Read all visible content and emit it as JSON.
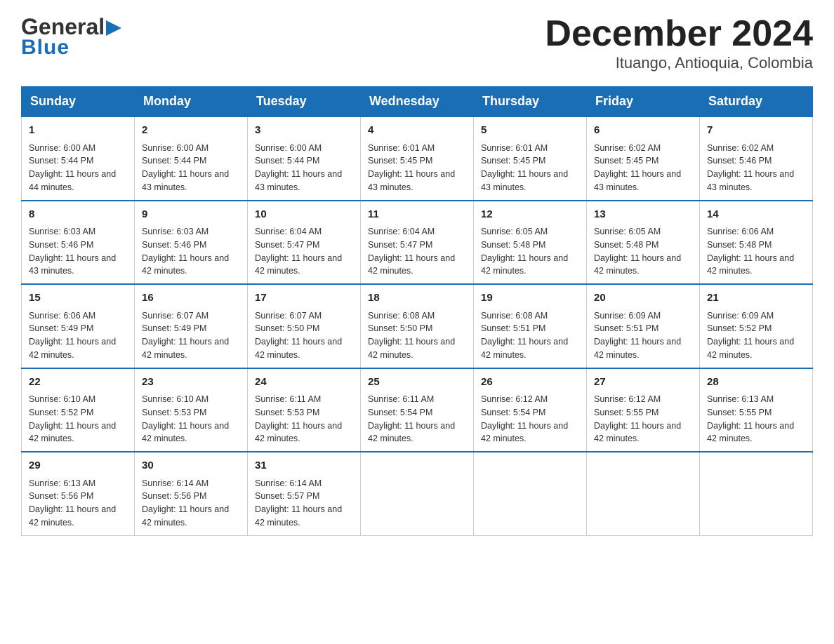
{
  "header": {
    "logo_top": "General",
    "logo_arrow": "▶",
    "logo_bottom": "Blue",
    "title": "December 2024",
    "subtitle": "Ituango, Antioquia, Colombia"
  },
  "calendar": {
    "days_of_week": [
      "Sunday",
      "Monday",
      "Tuesday",
      "Wednesday",
      "Thursday",
      "Friday",
      "Saturday"
    ],
    "weeks": [
      [
        {
          "day": "1",
          "sunrise": "6:00 AM",
          "sunset": "5:44 PM",
          "daylight": "11 hours and 44 minutes."
        },
        {
          "day": "2",
          "sunrise": "6:00 AM",
          "sunset": "5:44 PM",
          "daylight": "11 hours and 43 minutes."
        },
        {
          "day": "3",
          "sunrise": "6:00 AM",
          "sunset": "5:44 PM",
          "daylight": "11 hours and 43 minutes."
        },
        {
          "day": "4",
          "sunrise": "6:01 AM",
          "sunset": "5:45 PM",
          "daylight": "11 hours and 43 minutes."
        },
        {
          "day": "5",
          "sunrise": "6:01 AM",
          "sunset": "5:45 PM",
          "daylight": "11 hours and 43 minutes."
        },
        {
          "day": "6",
          "sunrise": "6:02 AM",
          "sunset": "5:45 PM",
          "daylight": "11 hours and 43 minutes."
        },
        {
          "day": "7",
          "sunrise": "6:02 AM",
          "sunset": "5:46 PM",
          "daylight": "11 hours and 43 minutes."
        }
      ],
      [
        {
          "day": "8",
          "sunrise": "6:03 AM",
          "sunset": "5:46 PM",
          "daylight": "11 hours and 43 minutes."
        },
        {
          "day": "9",
          "sunrise": "6:03 AM",
          "sunset": "5:46 PM",
          "daylight": "11 hours and 42 minutes."
        },
        {
          "day": "10",
          "sunrise": "6:04 AM",
          "sunset": "5:47 PM",
          "daylight": "11 hours and 42 minutes."
        },
        {
          "day": "11",
          "sunrise": "6:04 AM",
          "sunset": "5:47 PM",
          "daylight": "11 hours and 42 minutes."
        },
        {
          "day": "12",
          "sunrise": "6:05 AM",
          "sunset": "5:48 PM",
          "daylight": "11 hours and 42 minutes."
        },
        {
          "day": "13",
          "sunrise": "6:05 AM",
          "sunset": "5:48 PM",
          "daylight": "11 hours and 42 minutes."
        },
        {
          "day": "14",
          "sunrise": "6:06 AM",
          "sunset": "5:48 PM",
          "daylight": "11 hours and 42 minutes."
        }
      ],
      [
        {
          "day": "15",
          "sunrise": "6:06 AM",
          "sunset": "5:49 PM",
          "daylight": "11 hours and 42 minutes."
        },
        {
          "day": "16",
          "sunrise": "6:07 AM",
          "sunset": "5:49 PM",
          "daylight": "11 hours and 42 minutes."
        },
        {
          "day": "17",
          "sunrise": "6:07 AM",
          "sunset": "5:50 PM",
          "daylight": "11 hours and 42 minutes."
        },
        {
          "day": "18",
          "sunrise": "6:08 AM",
          "sunset": "5:50 PM",
          "daylight": "11 hours and 42 minutes."
        },
        {
          "day": "19",
          "sunrise": "6:08 AM",
          "sunset": "5:51 PM",
          "daylight": "11 hours and 42 minutes."
        },
        {
          "day": "20",
          "sunrise": "6:09 AM",
          "sunset": "5:51 PM",
          "daylight": "11 hours and 42 minutes."
        },
        {
          "day": "21",
          "sunrise": "6:09 AM",
          "sunset": "5:52 PM",
          "daylight": "11 hours and 42 minutes."
        }
      ],
      [
        {
          "day": "22",
          "sunrise": "6:10 AM",
          "sunset": "5:52 PM",
          "daylight": "11 hours and 42 minutes."
        },
        {
          "day": "23",
          "sunrise": "6:10 AM",
          "sunset": "5:53 PM",
          "daylight": "11 hours and 42 minutes."
        },
        {
          "day": "24",
          "sunrise": "6:11 AM",
          "sunset": "5:53 PM",
          "daylight": "11 hours and 42 minutes."
        },
        {
          "day": "25",
          "sunrise": "6:11 AM",
          "sunset": "5:54 PM",
          "daylight": "11 hours and 42 minutes."
        },
        {
          "day": "26",
          "sunrise": "6:12 AM",
          "sunset": "5:54 PM",
          "daylight": "11 hours and 42 minutes."
        },
        {
          "day": "27",
          "sunrise": "6:12 AM",
          "sunset": "5:55 PM",
          "daylight": "11 hours and 42 minutes."
        },
        {
          "day": "28",
          "sunrise": "6:13 AM",
          "sunset": "5:55 PM",
          "daylight": "11 hours and 42 minutes."
        }
      ],
      [
        {
          "day": "29",
          "sunrise": "6:13 AM",
          "sunset": "5:56 PM",
          "daylight": "11 hours and 42 minutes."
        },
        {
          "day": "30",
          "sunrise": "6:14 AM",
          "sunset": "5:56 PM",
          "daylight": "11 hours and 42 minutes."
        },
        {
          "day": "31",
          "sunrise": "6:14 AM",
          "sunset": "5:57 PM",
          "daylight": "11 hours and 42 minutes."
        },
        null,
        null,
        null,
        null
      ]
    ]
  }
}
